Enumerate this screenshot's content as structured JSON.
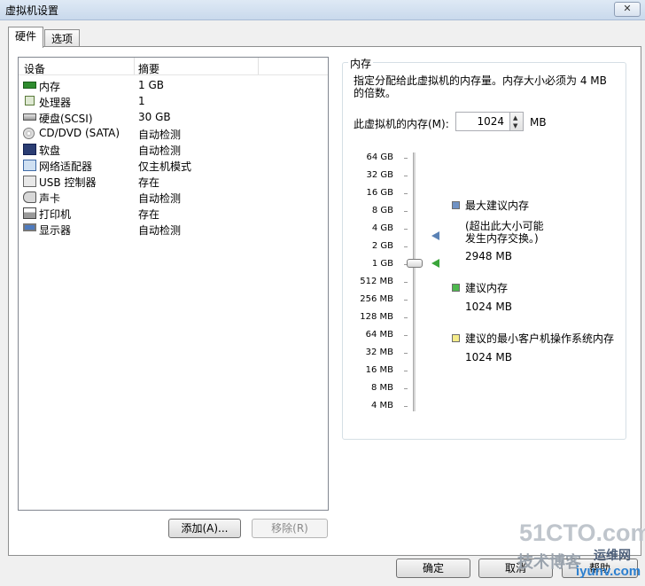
{
  "window": {
    "title": "虚拟机设置"
  },
  "tabs": [
    {
      "label": "硬件"
    },
    {
      "label": "选项"
    }
  ],
  "device_list": {
    "headers": {
      "device": "设备",
      "summary": "摘要"
    },
    "rows": [
      {
        "name": "内存",
        "summary": "1 GB",
        "icon": "memory-icon"
      },
      {
        "name": "处理器",
        "summary": "1",
        "icon": "processor-icon"
      },
      {
        "name": "硬盘(SCSI)",
        "summary": "30 GB",
        "icon": "hard-disk-icon"
      },
      {
        "name": "CD/DVD (SATA)",
        "summary": "自动检测",
        "icon": "cd-dvd-icon"
      },
      {
        "name": "软盘",
        "summary": "自动检测",
        "icon": "floppy-icon"
      },
      {
        "name": "网络适配器",
        "summary": "仅主机模式",
        "icon": "network-adapter-icon"
      },
      {
        "name": "USB 控制器",
        "summary": "存在",
        "icon": "usb-icon"
      },
      {
        "name": "声卡",
        "summary": "自动检测",
        "icon": "sound-card-icon"
      },
      {
        "name": "打印机",
        "summary": "存在",
        "icon": "printer-icon"
      },
      {
        "name": "显示器",
        "summary": "自动检测",
        "icon": "display-icon"
      }
    ],
    "add_label": "添加(A)...",
    "remove_label": "移除(R)"
  },
  "memory": {
    "group_title": "内存",
    "description": "指定分配给此虚拟机的内存量。内存大小必须为 4 MB 的倍数。",
    "field_label": "此虚拟机的内存(M):",
    "value": "1024",
    "unit": "MB",
    "scale_labels": [
      "64 GB",
      "32 GB",
      "16 GB",
      "8 GB",
      "4 GB",
      "2 GB",
      "1 GB",
      "512 MB",
      "256 MB",
      "128 MB",
      "64 MB",
      "32 MB",
      "16 MB",
      "8 MB",
      "4 MB"
    ],
    "slider_value": "1 GB",
    "legend": {
      "max": {
        "title": "最大建议内存",
        "note_line1": "(超出此大小可能",
        "note_line2": "发生内存交换。)",
        "value": "2948 MB",
        "color": "#6f92c4"
      },
      "recommended": {
        "title": "建议内存",
        "value": "1024 MB",
        "color": "#4db84d"
      },
      "min_guest": {
        "title": "建议的最小客户机操作系统内存",
        "value": "1024 MB",
        "color": "#f5ec8a"
      }
    }
  },
  "footer": {
    "ok_label": "确定",
    "cancel_label": "取消",
    "help_label": "帮助"
  },
  "watermark": {
    "line1": "51CTO.com",
    "line2": "技术博客",
    "line3": "运维网",
    "line4": "iyunv.com"
  }
}
